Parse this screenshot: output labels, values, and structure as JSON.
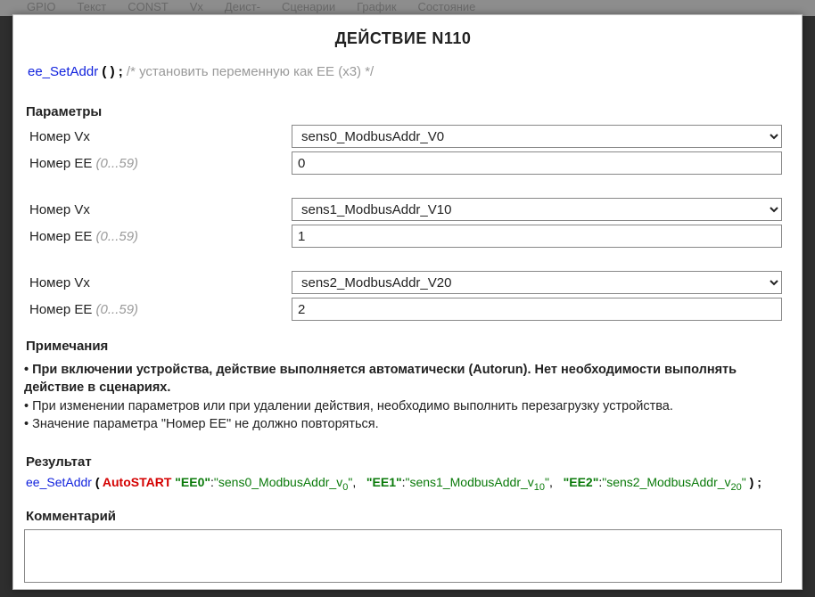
{
  "bg_tabs": [
    "GPIO",
    "Текст",
    "CONST",
    "Vx",
    "Деист-",
    "Сценарии",
    "График",
    "Состояние"
  ],
  "title": "ДЕЙСТВИЕ N110",
  "code": {
    "fn": "ee_SetAddr",
    "comment": "/* установить переменную как EE (x3) */"
  },
  "sections": {
    "params": "Параметры",
    "notes": "Примечания",
    "result": "Результат",
    "comment": "Комментарий"
  },
  "labels": {
    "vx": "Номер Vx",
    "ee": "Номер EE",
    "ee_hint": "(0...59)"
  },
  "rows": [
    {
      "vx_selected": "sens0_ModbusAddr_V0",
      "ee_value": "0"
    },
    {
      "vx_selected": "sens1_ModbusAddr_V10",
      "ee_value": "1"
    },
    {
      "vx_selected": "sens2_ModbusAddr_V20",
      "ee_value": "2"
    }
  ],
  "notes_lines": [
    {
      "bullet": "•",
      "bold": true,
      "text": "При включении устройства, действие выполняется автоматически (Autorun). Нет необходимости выполнять действие в сценариях."
    },
    {
      "bullet": "•",
      "bold": false,
      "text": "При изменении параметров или при удалении действия, необходимо выполнить перезагрузку устройства."
    },
    {
      "bullet": "•",
      "bold": false,
      "text": "Значение параметра \"Номер EE\" не должно повторяться."
    }
  ],
  "result": {
    "fn": "ee_SetAddr",
    "auto": "AutoSTART",
    "pairs": [
      {
        "key": "\"EE0\"",
        "val_main": "\"sens0_ModbusAddr_v",
        "val_sub": "0",
        "val_tail": "\""
      },
      {
        "key": "\"EE1\"",
        "val_main": "\"sens1_ModbusAddr_v",
        "val_sub": "10",
        "val_tail": "\""
      },
      {
        "key": "\"EE2\"",
        "val_main": "\"sens2_ModbusAddr_v",
        "val_sub": "20",
        "val_tail": "\""
      }
    ]
  },
  "comment_value": ""
}
